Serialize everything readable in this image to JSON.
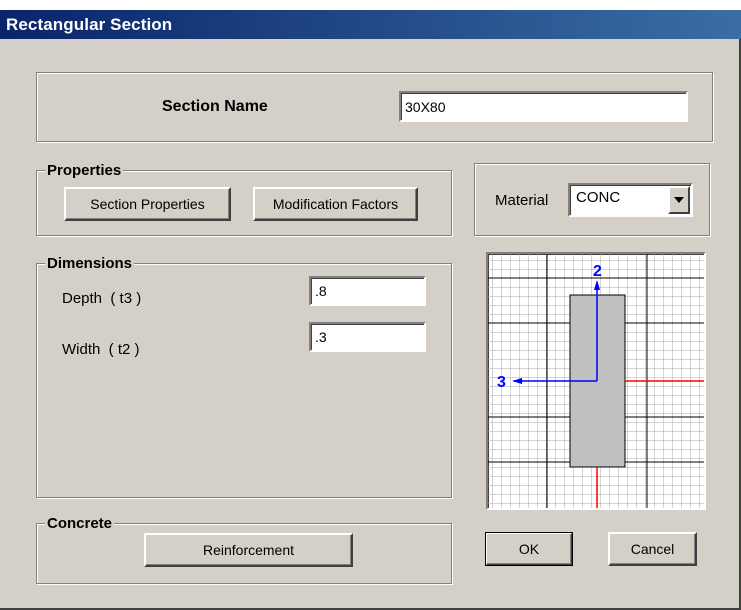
{
  "window": {
    "title": "Rectangular Section"
  },
  "section_name": {
    "label": "Section Name",
    "value": "30X80"
  },
  "properties": {
    "group_label": "Properties",
    "section_properties_button": "Section Properties",
    "modification_factors_button": "Modification Factors"
  },
  "material": {
    "label": "Material",
    "selected": "CONC"
  },
  "dimensions": {
    "group_label": "Dimensions",
    "depth_label": "Depth  ( t3 )",
    "depth_value": ".8",
    "width_label": "Width  ( t2 )",
    "width_value": ".3"
  },
  "preview": {
    "axis_2_label": "2",
    "axis_3_label": "3"
  },
  "concrete": {
    "group_label": "Concrete",
    "reinforcement_button": "Reinforcement"
  },
  "buttons": {
    "ok": "OK",
    "cancel": "Cancel"
  },
  "colors": {
    "axis_blue": "#0000ff",
    "centerline_red": "#ff0000",
    "section_fill": "#c0c0c0"
  }
}
